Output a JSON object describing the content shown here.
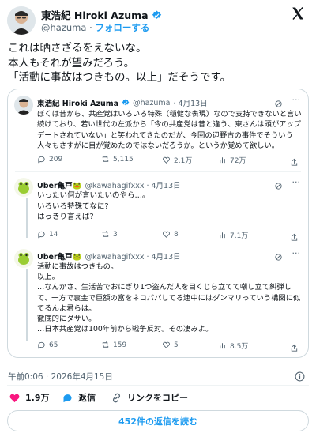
{
  "header": {
    "name": "東浩紀 Hiroki Azuma",
    "handle": "@hazuma",
    "separator": "·",
    "follow_label": "フォローする",
    "close_glyph": "X"
  },
  "tweet": {
    "lines": [
      "これは晒さざるをえないな。",
      "本人もそれが望みだろう。",
      "「活動に事故はつきもの。以上」だそうです。"
    ],
    "timestamp": "午前0:06 · 2026年4月15日"
  },
  "quoted": {
    "name": "東浩紀 Hiroki Azuma",
    "handle": "@hazuma",
    "date": "· 4月13日",
    "body": "ぼくは昔から、共産党はいろいろ特殊（穏健な表現）なので支持できないと言い続けており、若い世代の左派から「今の共産党は昔と違う、東さんは頭がアップデートされていない」と笑われてきたのだが、今回の辺野古の事件でそういう人々もさすがに目が覚めたのではないだろうか。というか覚めて欲しい。",
    "stats": {
      "replies": "209",
      "retweets": "5,115",
      "likes": "2.1万",
      "views": "72万"
    }
  },
  "reply1": {
    "name": "Uber亀戸🐸",
    "handle": "@kawahagifxxx · 4月13日",
    "lines": [
      "いったい何が言いたいのやら…。",
      "いろいろ特殊てなに?",
      "はっきり言えば?"
    ],
    "stats": {
      "replies": "14",
      "retweets": "3",
      "likes": "8",
      "views": "7.1万"
    }
  },
  "reply2": {
    "name": "Uber亀戸🐸",
    "handle": "@kawahagifxxx · 4月13日",
    "lines": [
      "活動に事故はつきもの。",
      "以上。",
      "…なんかさ、生活苦でおにぎり1つ盗んだ人を目くじら立てて嘲し立て糾弾して、一方で裏金で巨額の富をネコババしてる連中にはダンマリっていう構図に似てるんよ君らは。",
      "徹底的にダサい。",
      "…日本共産党は100年前から戦争反対。その凄みよ。"
    ],
    "stats": {
      "replies": "65",
      "retweets": "159",
      "likes": "5",
      "views": "8.5万"
    }
  },
  "footer": {
    "likes": "1.9万",
    "reply_label": "返信",
    "copy_link_label": "リンクをコピー",
    "read_replies": "452件の返信を読む"
  },
  "colors": {
    "accent": "#1d9bf0",
    "like": "#f91880",
    "text": "#0f1419",
    "muted": "#536471",
    "border": "#cfd9de"
  }
}
